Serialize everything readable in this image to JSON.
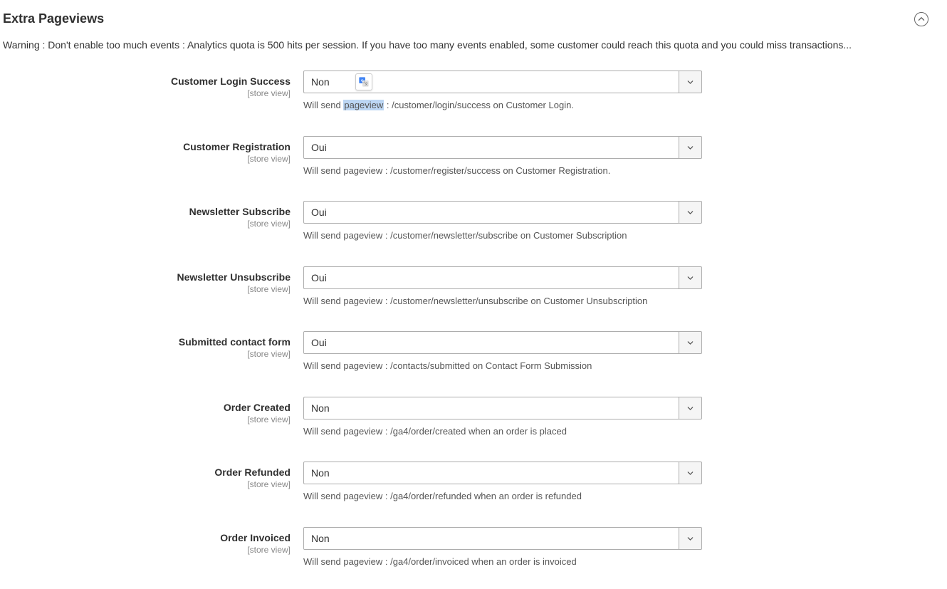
{
  "section": {
    "title": "Extra Pageviews",
    "warning": "Warning : Don't enable too much events : Analytics quota is 500 hits per session. If you have too many events enabled, some customer could reach this quota and you could miss transactions..."
  },
  "scope_label": "[store view]",
  "fields": [
    {
      "key": "customer_login",
      "label": "Customer Login Success",
      "value": "Non",
      "has_translate_badge": true,
      "note_pre": "Will send ",
      "note_highlight": "pageview",
      "note_post": " : /customer/login/success on Customer Login."
    },
    {
      "key": "customer_registration",
      "label": "Customer Registration",
      "value": "Oui",
      "note": "Will send pageview : /customer/register/success on Customer Registration."
    },
    {
      "key": "newsletter_subscribe",
      "label": "Newsletter Subscribe",
      "value": "Oui",
      "note": "Will send pageview : /customer/newsletter/subscribe on Customer Subscription"
    },
    {
      "key": "newsletter_unsubscribe",
      "label": "Newsletter Unsubscribe",
      "value": "Oui",
      "note": "Will send pageview : /customer/newsletter/unsubscribe on Customer Unsubscription"
    },
    {
      "key": "submitted_contact",
      "label": "Submitted contact form",
      "value": "Oui",
      "note": "Will send pageview : /contacts/submitted on Contact Form Submission"
    },
    {
      "key": "order_created",
      "label": "Order Created",
      "value": "Non",
      "note": "Will send pageview : /ga4/order/created when an order is placed"
    },
    {
      "key": "order_refunded",
      "label": "Order Refunded",
      "value": "Non",
      "note": "Will send pageview : /ga4/order/refunded when an order is refunded"
    },
    {
      "key": "order_invoiced",
      "label": "Order Invoiced",
      "value": "Non",
      "note": "Will send pageview : /ga4/order/invoiced when an order is invoiced"
    }
  ]
}
